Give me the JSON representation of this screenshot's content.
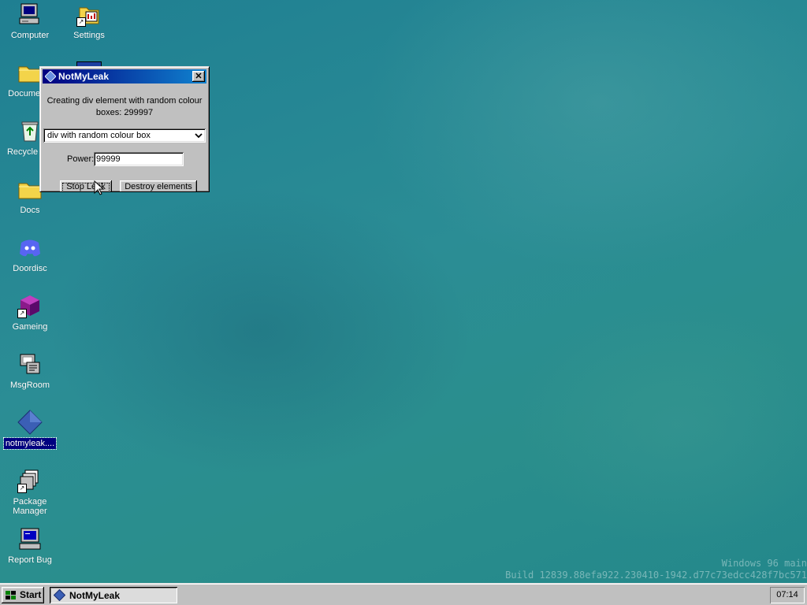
{
  "desktop": {
    "icons": [
      {
        "label": "Computer",
        "icon": "computer-icon"
      },
      {
        "label": "Settings",
        "icon": "settings-icon"
      },
      {
        "label": "Documents",
        "icon": "folder-icon"
      },
      {
        "label": "Recycle Bin",
        "icon": "recycle-bin-icon"
      },
      {
        "label": "Docs",
        "icon": "folder-icon"
      },
      {
        "label": "Doordisc",
        "icon": "doordisc-icon"
      },
      {
        "label": "Gameing",
        "icon": "game-cube-icon"
      },
      {
        "label": "MsgRoom",
        "icon": "msgroom-icon"
      },
      {
        "label": "notmyleak....",
        "icon": "diamond-icon"
      },
      {
        "label": "Package Manager",
        "icon": "package-manager-icon"
      },
      {
        "label": "Report Bug",
        "icon": "report-bug-icon"
      }
    ]
  },
  "window": {
    "title": "NotMyLeak",
    "status_line1": "Creating div element with random colour",
    "status_line2": "boxes: 299997",
    "select_value": "div with random colour box",
    "power_label": "Power:",
    "power_value": "99999",
    "stop_button": "Stop Leak",
    "destroy_button": "Destroy elements",
    "close_label": "✕"
  },
  "build": {
    "line1": "Windows 96 main",
    "line2": "Build 12839.88efa922.230410-1942.d77c73edcc428f7bc571"
  },
  "taskbar": {
    "start_label": "Start",
    "task_label": "NotMyLeak",
    "clock": "07:14"
  },
  "colors": {
    "title_active": "#000080",
    "selection": "#000080",
    "desktop": "#2a8a93"
  }
}
